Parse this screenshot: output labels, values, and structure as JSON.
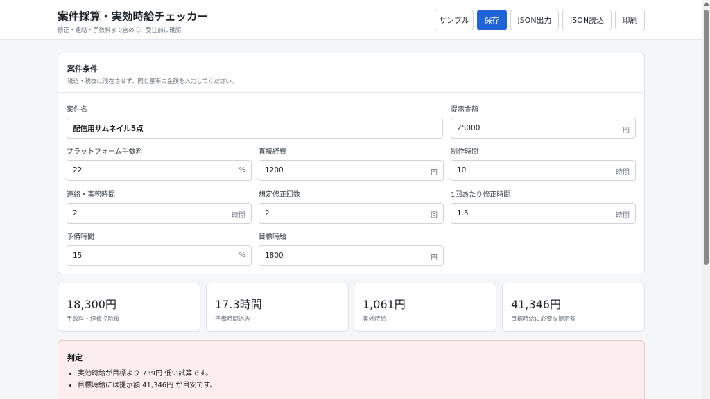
{
  "header": {
    "title": "案件採算・実効時給チェッカー",
    "subtitle": "修正・連絡・手数料まで含めて、受注前に確認",
    "buttons": {
      "sample": "サンプル",
      "save": "保存",
      "json_export": "JSON出力",
      "json_import": "JSON読込",
      "print": "印刷"
    }
  },
  "conditions": {
    "title": "案件条件",
    "note": "税込・税抜は混在させず、同じ基準の金額を入力してください。",
    "fields": {
      "project_name": {
        "label": "案件名",
        "value": "配信用サムネイル5点",
        "unit": ""
      },
      "offer_amount": {
        "label": "提示金額",
        "value": "25000",
        "unit": "円"
      },
      "platform_fee": {
        "label": "プラットフォーム手数料",
        "value": "22",
        "unit": "%"
      },
      "direct_cost": {
        "label": "直接経費",
        "value": "1200",
        "unit": "円"
      },
      "production_time": {
        "label": "制作時間",
        "value": "10",
        "unit": "時間"
      },
      "contact_time": {
        "label": "連絡・事務時間",
        "value": "2",
        "unit": "時間"
      },
      "revision_count": {
        "label": "想定修正回数",
        "value": "2",
        "unit": "回"
      },
      "revision_time": {
        "label": "1回あたり修正時間",
        "value": "1.5",
        "unit": "時間"
      },
      "buffer_time": {
        "label": "予備時間",
        "value": "15",
        "unit": "%"
      },
      "target_wage": {
        "label": "目標時給",
        "value": "1800",
        "unit": "円"
      }
    }
  },
  "stats": [
    {
      "value": "18,300円",
      "label": "手数料・経費控除後"
    },
    {
      "value": "17.3時間",
      "label": "予備時間込み"
    },
    {
      "value": "1,061円",
      "label": "実効時給"
    },
    {
      "value": "41,346円",
      "label": "目標時給に必要な提示額"
    }
  ],
  "verdict": {
    "title": "判定",
    "items": [
      "実効時給が目標より 739円 低い試算です。",
      "目標時給には提示額 41,346円 が目安です。"
    ]
  },
  "colors": {
    "primary": "#1f63d8",
    "verdict_bg": "#fdeeee",
    "verdict_border": "#f1c8c8"
  }
}
